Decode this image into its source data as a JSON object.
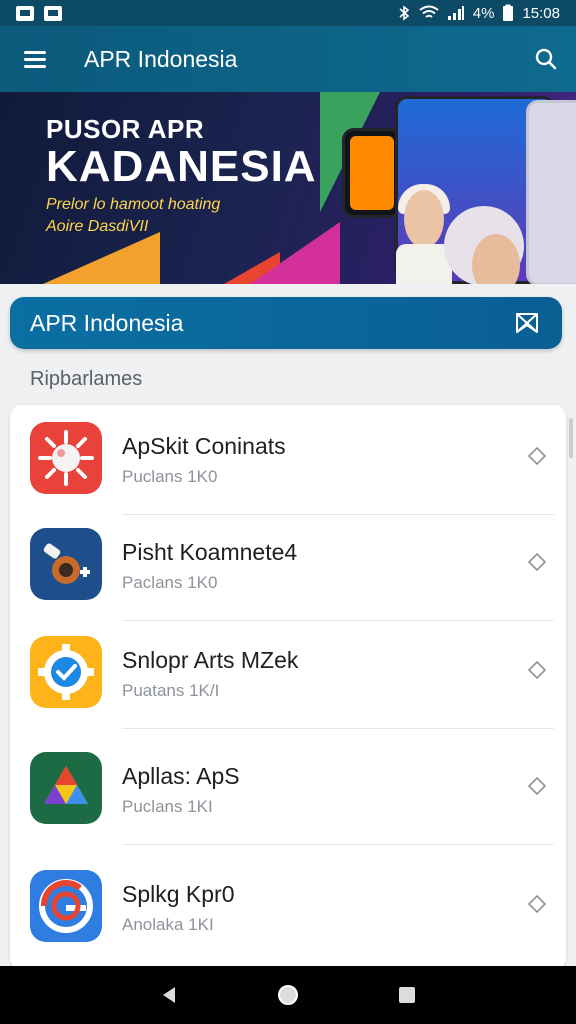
{
  "status_bar": {
    "battery": "4%",
    "time": "15:08",
    "battery_text": "4",
    "notif_icons": [
      "notification-icon",
      "message-icon"
    ]
  },
  "app_bar": {
    "title": "APR Indonesia"
  },
  "banner": {
    "line1": "PUSOR APR",
    "line2": "KADANESIA",
    "line3": "Prelor lo hamoot hoating",
    "line4": "Aoire DasdiVII"
  },
  "section_header": {
    "title": "APR Indonesia"
  },
  "sub_heading": "Ripbarlames",
  "apps": [
    {
      "name": "ApSkit Coninats",
      "meta": "Puclans   1K0",
      "icon": "sun-ball-icon"
    },
    {
      "name": "Pisht Koamnete4",
      "meta": "Paclans   1K0",
      "icon": "telescope-icon"
    },
    {
      "name": "Snlopr Arts MZek",
      "meta": "Puatans   1K/I",
      "icon": "gear-check-icon"
    },
    {
      "name": "Apllas: ApS",
      "meta": "Puclans   1KI",
      "icon": "drive-triangle-icon"
    },
    {
      "name": "Splkg Kpr0",
      "meta": "Anolaka   1KI",
      "icon": "g-swirl-icon"
    }
  ],
  "colors": {
    "app_bar": "#0c5a7c",
    "section_header": "#0b6fa3",
    "accent_yellow": "#ffd54a"
  }
}
